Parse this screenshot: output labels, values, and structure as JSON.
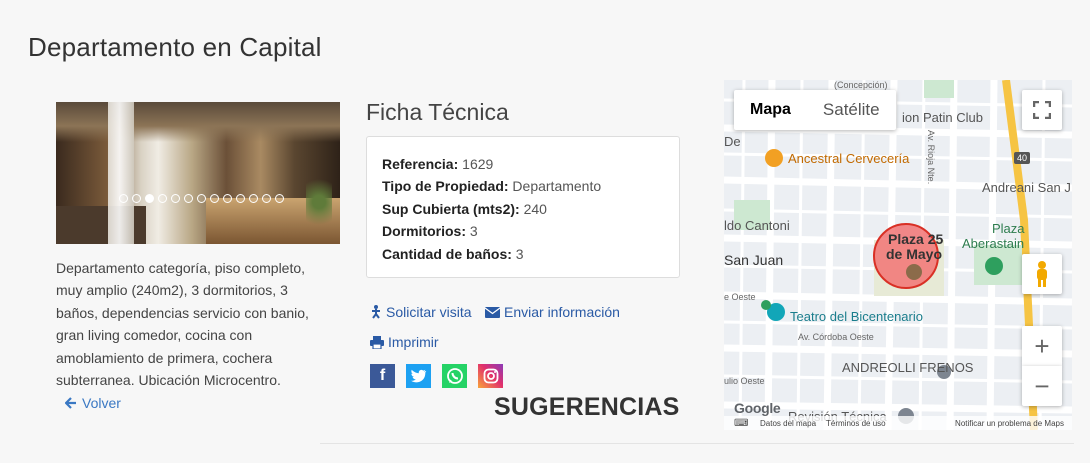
{
  "page": {
    "title": "Departamento en Capital"
  },
  "gallery": {
    "dots_total": 13,
    "active_index": 2
  },
  "description": "Departamento categoría, piso completo, muy amplio (240m2), 3 dormitorios, 3 baños, dependencias servicio con banio, gran living comedor, cocina con amoblamiento de primera, cochera subterranea. Ubicación Microcentro.",
  "back": {
    "label": "Volver",
    "icon": "arrow-left-icon"
  },
  "ficha": {
    "title": "Ficha Técnica",
    "rows": [
      {
        "label": "Referencia:",
        "value": "1629"
      },
      {
        "label": "Tipo de Propiedad:",
        "value": "Departamento"
      },
      {
        "label": "Sup Cubierta (mts2):",
        "value": "240"
      },
      {
        "label": "Dormitorios:",
        "value": "3"
      },
      {
        "label": "Cantidad de baños:",
        "value": "3"
      }
    ]
  },
  "actions": {
    "visit": {
      "label": "Solicitar visita",
      "icon": "person-walking-icon"
    },
    "email": {
      "label": "Enviar información",
      "icon": "envelope-icon"
    },
    "print": {
      "label": "Imprimir",
      "icon": "printer-icon"
    }
  },
  "social": [
    {
      "name": "facebook",
      "glyph": "f",
      "color": "#3b5998"
    },
    {
      "name": "twitter",
      "glyph": "t",
      "color": "#1da1f2"
    },
    {
      "name": "whatsapp",
      "glyph": "w",
      "color": "#25d366"
    },
    {
      "name": "instagram",
      "glyph": "i",
      "color": "#e1306c"
    }
  ],
  "sugerencias": "SUGERENCIAS",
  "map": {
    "type_map": "Mapa",
    "type_satellite": "Satélite",
    "zoom_in": "+",
    "zoom_out": "−",
    "labels": {
      "concepcion": "(Concepción)",
      "patin": "ion Patin Club",
      "de": "De",
      "rioja": "Av. Rioja Nte.",
      "ancestral": "Ancestral Cervecería",
      "route": "40",
      "andreoni": "Andreani San J",
      "cantoni": "ldo Cantoni",
      "plaza_25_a": "Plaza 25",
      "plaza_25_b": "de Mayo",
      "plaza_aberastain_a": "Plaza",
      "plaza_aberastain_b": "Aberastain",
      "san_juan": "San Juan",
      "oeste": "e Oeste",
      "teatro": "Teatro del Bicentenario",
      "cordoba": "Av. Córdoba Oeste",
      "andreolli": "ANDREOLLI FRENOS",
      "julio": "ulio Oeste",
      "revision": "Revisión Técnica"
    },
    "footer": {
      "data": "Datos del mapa",
      "terms": "Términos de uso",
      "report": "Notificar un problema de Maps"
    },
    "logo": "Google"
  }
}
